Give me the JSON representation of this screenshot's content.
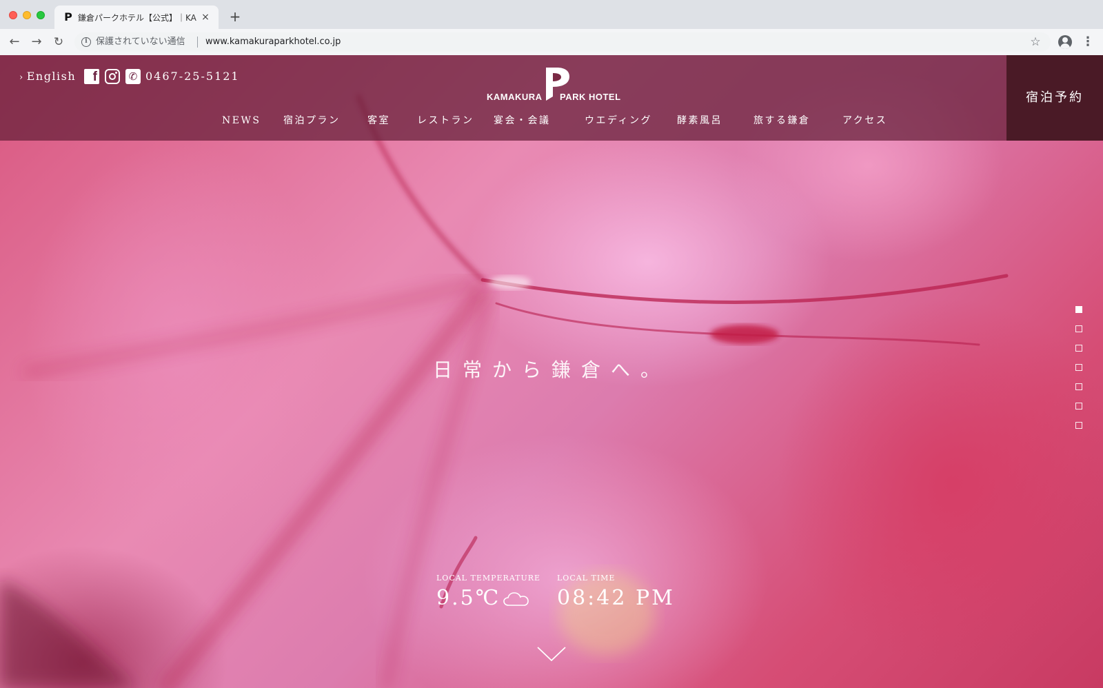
{
  "browser": {
    "tab_title": "鎌倉パークホテル【公式】｜KAMAKURA PARK HOTEL",
    "tab_close": "×",
    "new_tab": "+",
    "back": "←",
    "forward": "→",
    "reload": "↻",
    "security_text": "保護されていない通信",
    "url": "www.kamakuraparkhotel.co.jp",
    "bookmark": "☆",
    "menu": "⋮"
  },
  "header": {
    "english_link": "English",
    "phone": "0467-25-5121",
    "logo_left": "KAMAKURA",
    "logo_right": "PARK HOTEL",
    "booking_label": "宿泊予約",
    "nav": [
      {
        "label": "NEWS"
      },
      {
        "label": "宿泊プラン"
      },
      {
        "label": "客室"
      },
      {
        "label": "レストラン"
      },
      {
        "label": "宴会・会議"
      },
      {
        "label": "ウエディング"
      },
      {
        "label": "酵素風呂"
      },
      {
        "label": "旅する鎌倉"
      },
      {
        "label": "アクセス"
      }
    ]
  },
  "hero": {
    "copy": "日常から鎌倉へ。",
    "slides_total": 7,
    "active_slide": 1
  },
  "weather": {
    "temp_label": "LOCAL TEMPERATURE",
    "temp_value": "9.5℃",
    "weather_icon": "cloud-icon",
    "time_label": "LOCAL TIME",
    "time_value": "08:42 PM"
  },
  "colors": {
    "header_bg": "#641e37",
    "booking_bg": "#4a1a26",
    "leaf_pink": "#e98ab3",
    "leaf_red": "#d64d75"
  }
}
